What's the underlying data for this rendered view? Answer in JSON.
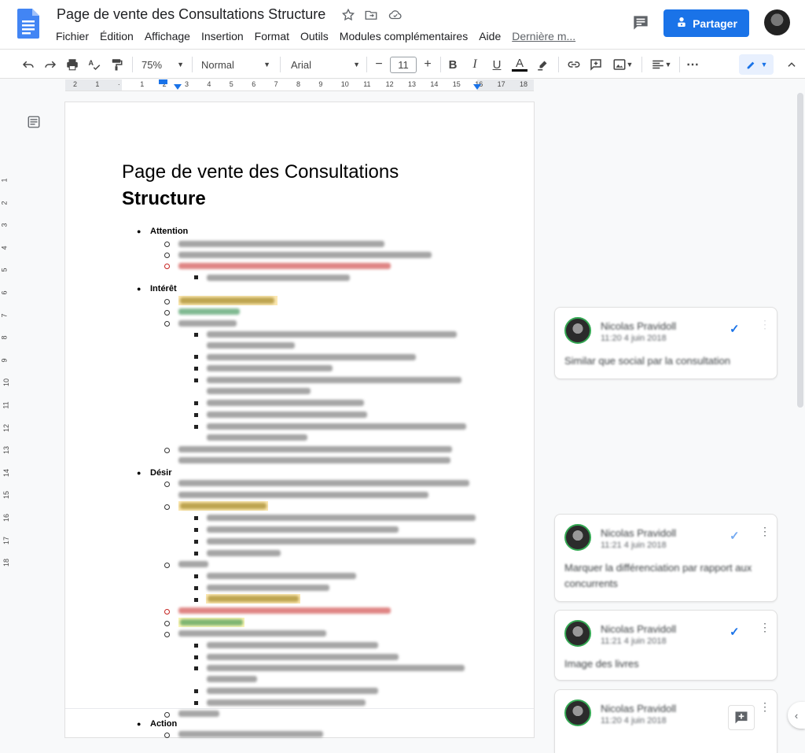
{
  "header": {
    "doc_title": "Page de vente des Consultations Structure",
    "share_label": "Partager",
    "menu": [
      "Fichier",
      "Édition",
      "Affichage",
      "Insertion",
      "Format",
      "Outils",
      "Modules complémentaires",
      "Aide"
    ],
    "last_edit": "Dernière m..."
  },
  "toolbar": {
    "zoom": "75%",
    "style": "Normal",
    "font": "Arial",
    "font_size": "11",
    "minus": "−",
    "plus": "+"
  },
  "ruler": {
    "numbers": [
      "2",
      "1",
      "",
      "1",
      "2",
      "3",
      "4",
      "5",
      "6",
      "7",
      "8",
      "9",
      "10",
      "11",
      "12",
      "13",
      "14",
      "15",
      "16",
      "17",
      "18"
    ]
  },
  "vruler": {
    "numbers": [
      "1",
      "2",
      "3",
      "4",
      "5",
      "6",
      "7",
      "8",
      "9",
      "10",
      "11",
      "12",
      "13",
      "14",
      "15",
      "16",
      "17",
      "18"
    ]
  },
  "document": {
    "heading_line1": "Page de vente des Consultations",
    "heading_line2": "Structure",
    "sections": {
      "attention": "Attention",
      "interet": "Intérêt",
      "desir": "Désir",
      "action": "Action"
    }
  },
  "comments": [
    {
      "author": "Nicolas Pravidoll",
      "time": "11:20 4 juin 2018",
      "body": "Similar que social par la consultation"
    },
    {
      "author": "Nicolas Pravidoll",
      "time": "11:21 4 juin 2018",
      "body": "Marquer la différenciation par rapport aux concurrents"
    },
    {
      "author": "Nicolas Pravidoll",
      "time": "11:21 4 juin 2018",
      "body": "Image des livres"
    },
    {
      "author": "Nicolas Pravidoll",
      "time": "11:20 4 juin 2018",
      "body": ""
    }
  ],
  "colors": {
    "accent": "#1a73e8",
    "comment_avatar_ring": "#34a853",
    "highlight_yellow": "#fce8b2",
    "red_text": "#c5221f",
    "green_text": "#188038"
  },
  "icons": [
    "docs-logo-icon",
    "star-icon",
    "move-folder-icon",
    "cloud-status-icon",
    "comment-history-icon",
    "lock-person-icon",
    "undo-icon",
    "redo-icon",
    "print-icon",
    "spellcheck-icon",
    "paint-format-icon",
    "bold-icon",
    "italic-icon",
    "underline-icon",
    "text-color-icon",
    "highlight-icon",
    "link-icon",
    "add-comment-icon",
    "insert-image-icon",
    "align-icon",
    "more-icon",
    "editing-mode-icon",
    "collapse-icon",
    "outline-icon",
    "resolve-check-icon",
    "more-vert-icon"
  ]
}
